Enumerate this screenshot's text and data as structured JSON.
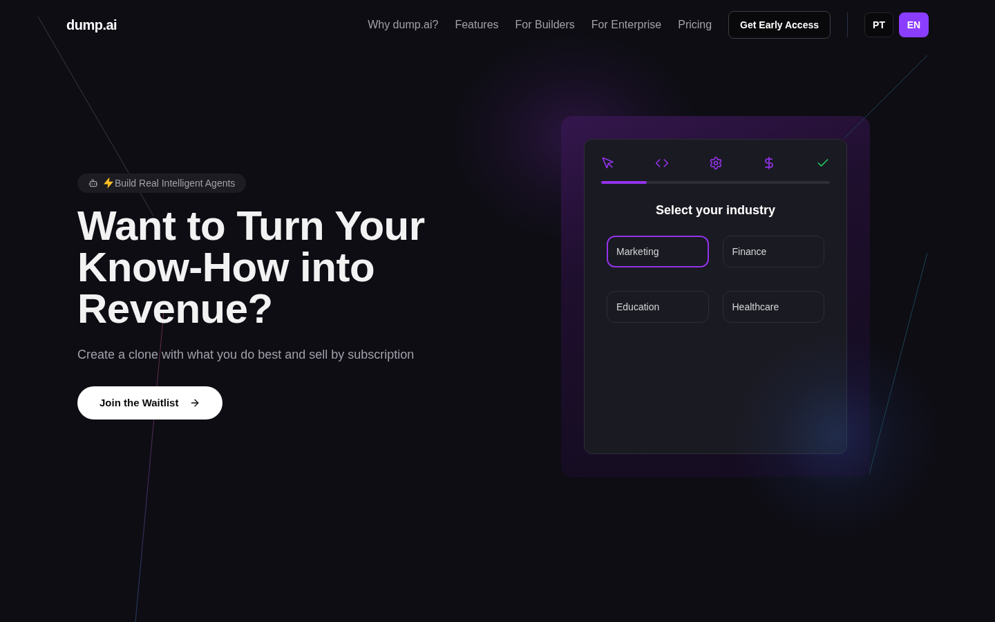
{
  "nav": {
    "logo": "dump.ai",
    "links": [
      "Why dump.ai?",
      "Features",
      "For Builders",
      "For Enterprise",
      "Pricing"
    ],
    "cta": "Get Early Access",
    "languages": [
      {
        "label": "PT",
        "selected": false
      },
      {
        "label": "EN",
        "selected": true
      }
    ]
  },
  "hero": {
    "badge": "Build Real Intelligent Agents",
    "title": "Want to Turn Your Know-How into Revenue?",
    "subtitle": "Create a clone with what you do best and sell by subscription",
    "cta": "Join the Waitlist"
  },
  "wizard": {
    "steps": [
      {
        "kind": "select"
      },
      {
        "kind": "code"
      },
      {
        "kind": "settings"
      },
      {
        "kind": "pricing"
      },
      {
        "kind": "done"
      }
    ],
    "progress": {
      "level": 0.2
    },
    "title": "Select your industry",
    "options": [
      {
        "label": "Marketing",
        "selected": true
      },
      {
        "label": "Finance",
        "selected": false
      },
      {
        "label": "Education",
        "selected": false
      },
      {
        "label": "Healthcare",
        "selected": false
      }
    ]
  }
}
